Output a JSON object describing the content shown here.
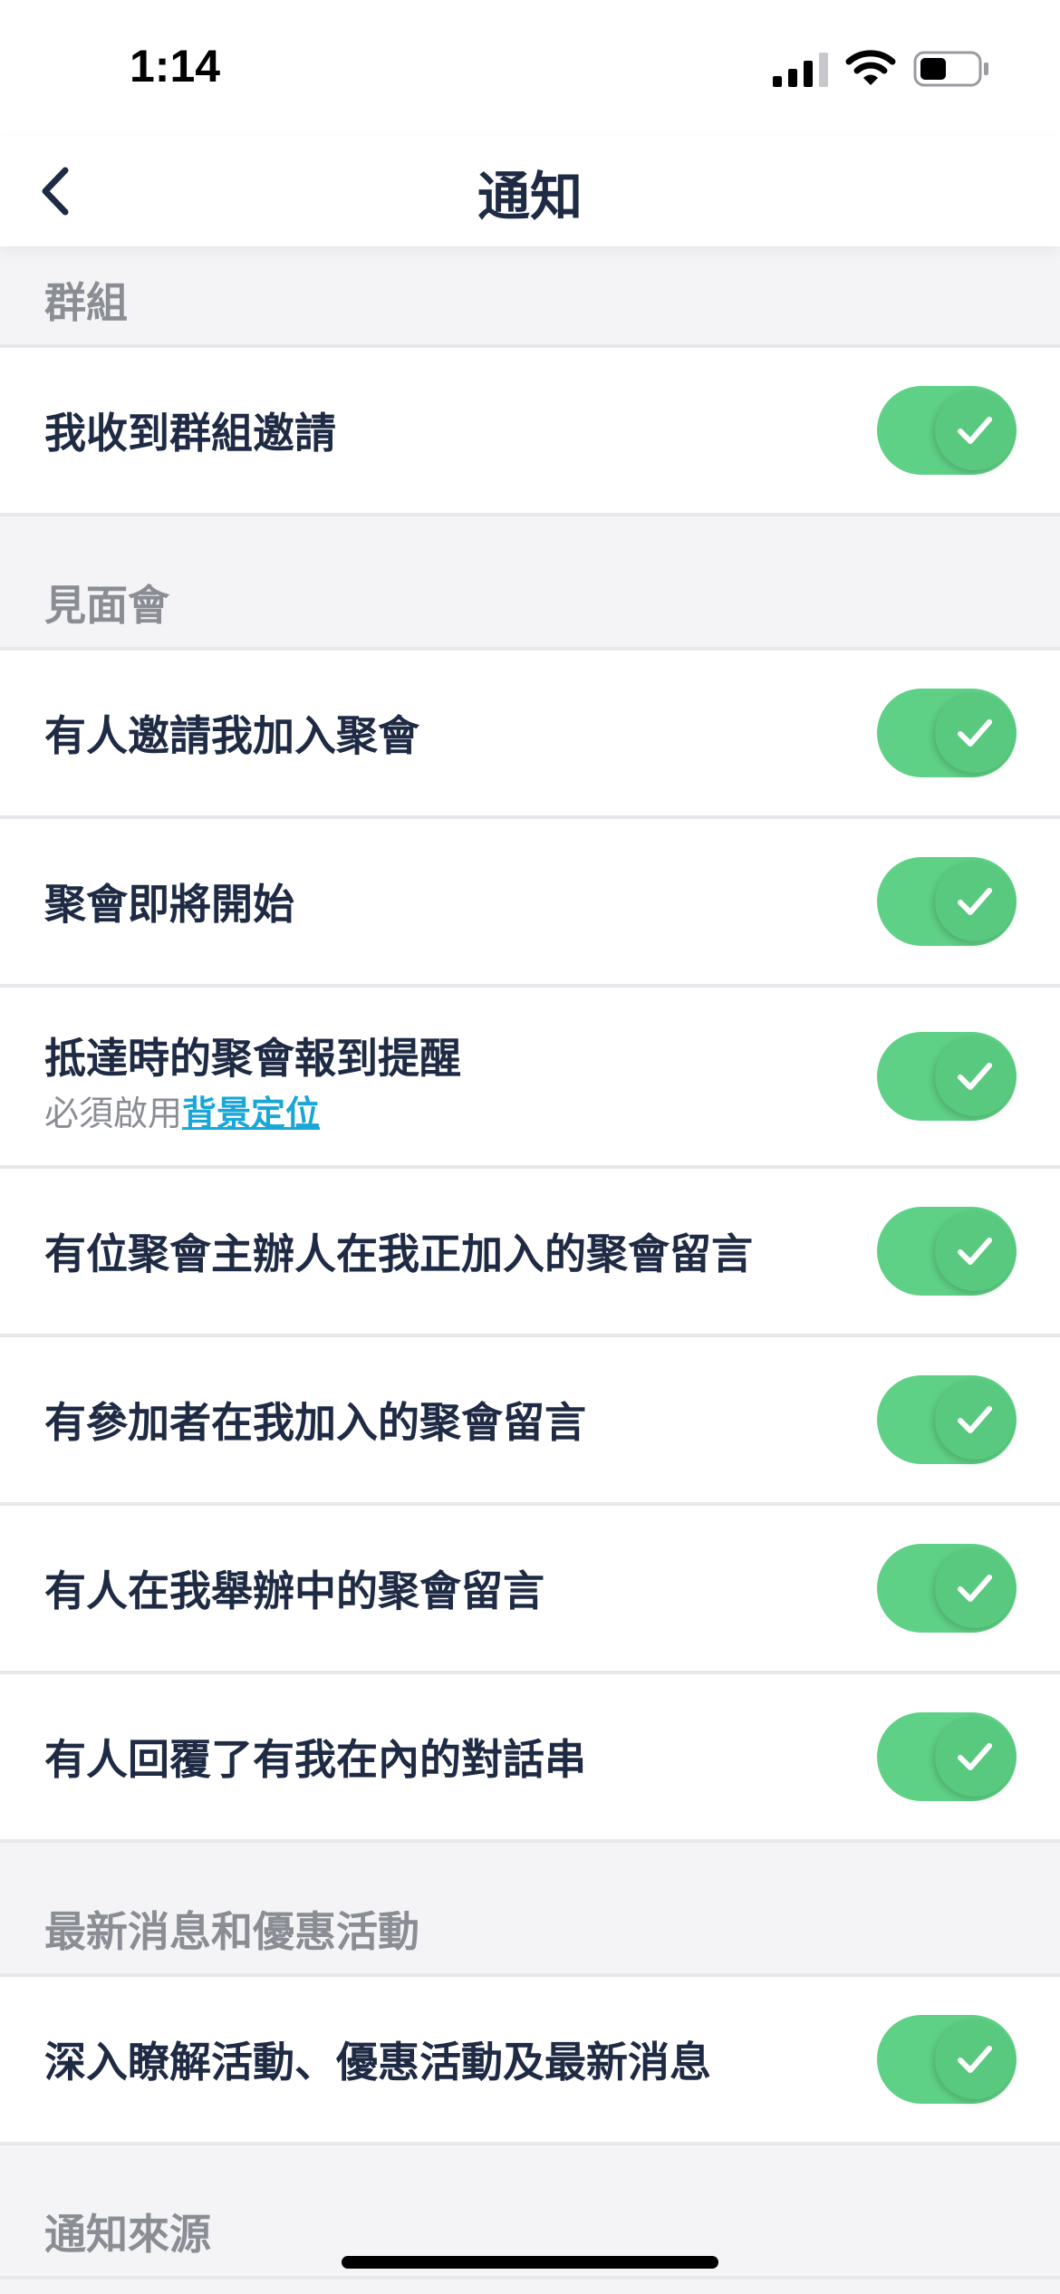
{
  "status_bar": {
    "time": "1:14"
  },
  "nav": {
    "title": "通知",
    "back_icon": "chevron-left-icon"
  },
  "sections": {
    "groups": {
      "title": "群組",
      "items": [
        {
          "label": "我收到群組邀請",
          "enabled": true
        }
      ]
    },
    "meetups": {
      "title": "見面會",
      "items": [
        {
          "label": "有人邀請我加入聚會",
          "enabled": true
        },
        {
          "label": "聚會即將開始",
          "enabled": true
        },
        {
          "label": "抵達時的聚會報到提醒",
          "sub_prefix": "必須啟用",
          "sub_link": "背景定位",
          "enabled": true
        },
        {
          "label": "有位聚會主辦人在我正加入的聚會留言",
          "enabled": true
        },
        {
          "label": "有參加者在我加入的聚會留言",
          "enabled": true
        },
        {
          "label": "有人在我舉辦中的聚會留言",
          "enabled": true
        },
        {
          "label": "有人回覆了有我在內的對話串",
          "enabled": true
        }
      ]
    },
    "news": {
      "title": "最新消息和優惠活動",
      "items": [
        {
          "label": "深入瞭解活動、優惠活動及最新消息",
          "enabled": true
        }
      ]
    },
    "sources": {
      "title": "通知來源"
    }
  },
  "colors": {
    "toggle_on": "#5fd186",
    "accent_link": "#1aa6d6",
    "text_primary": "#1f2b44",
    "text_secondary": "#8a8d94"
  }
}
